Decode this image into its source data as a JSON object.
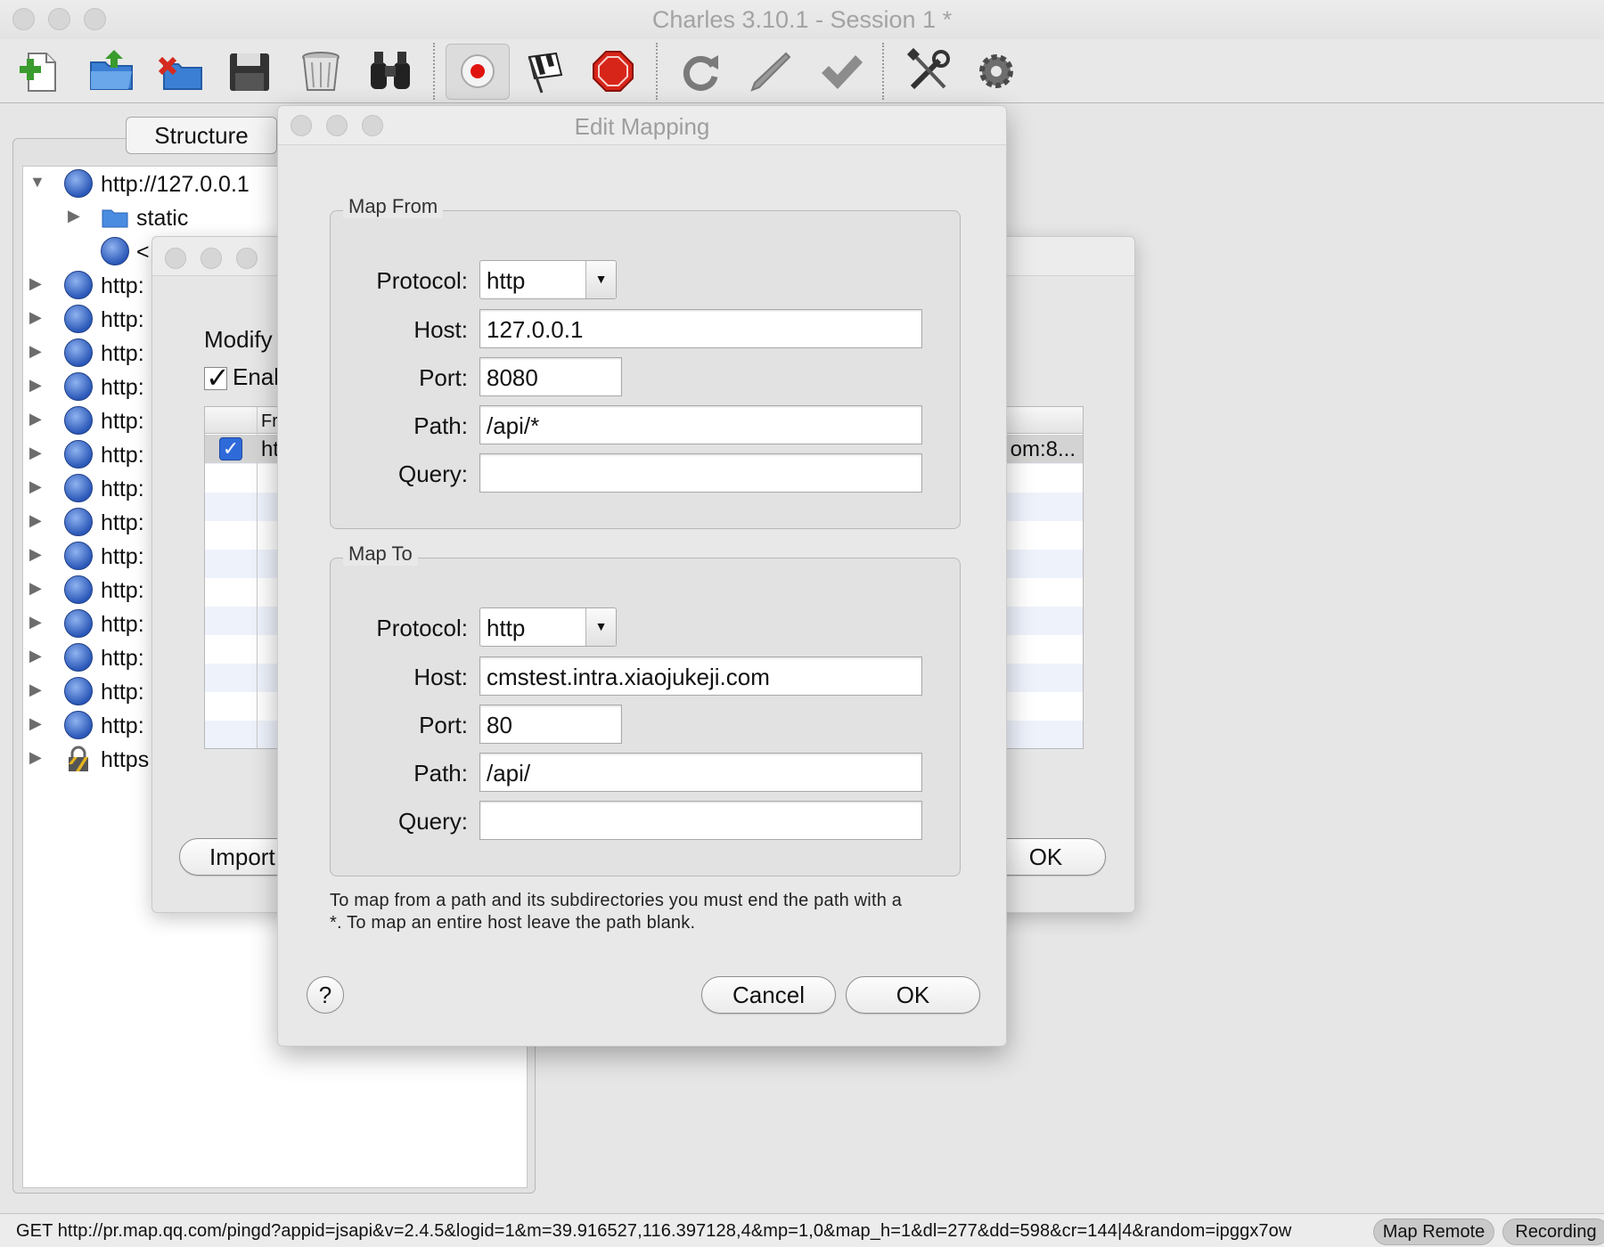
{
  "window": {
    "title": "Charles 3.10.1 - Session 1 *"
  },
  "toolbar": {
    "buttons": [
      {
        "icon": "new-session-icon",
        "tooltip": "New Session"
      },
      {
        "icon": "open-session-icon",
        "tooltip": "Open Session"
      },
      {
        "icon": "close-session-icon",
        "tooltip": "Close Session"
      },
      {
        "icon": "save-icon",
        "tooltip": "Save"
      },
      {
        "icon": "trash-icon",
        "tooltip": "Clear"
      },
      {
        "icon": "binoculars-icon",
        "tooltip": "Find"
      },
      {
        "icon": "record-icon",
        "tooltip": "Recording"
      },
      {
        "icon": "throttle-flag-icon",
        "tooltip": "Throttling"
      },
      {
        "icon": "stop-icon",
        "tooltip": "Breakpoints"
      },
      {
        "icon": "repeat-icon",
        "tooltip": "Repeat"
      },
      {
        "icon": "edit-pen-icon",
        "tooltip": "Edit"
      },
      {
        "icon": "validate-check-icon",
        "tooltip": "Validate"
      },
      {
        "icon": "tools-icon",
        "tooltip": "Tools"
      },
      {
        "icon": "settings-gear-icon",
        "tooltip": "Settings"
      }
    ]
  },
  "left_panel": {
    "tab_label": "Structure",
    "tree": [
      {
        "label": "http://127.0.0.1",
        "icon": "globe-icon",
        "expanded": true,
        "level": 0
      },
      {
        "label": "static",
        "icon": "folder-icon",
        "expanded": false,
        "level": 1
      },
      {
        "label": "<",
        "icon": "globe-icon",
        "level": 1
      },
      {
        "label": "http:",
        "icon": "globe-icon",
        "level": 0
      },
      {
        "label": "http:",
        "icon": "globe-icon",
        "level": 0
      },
      {
        "label": "http:",
        "icon": "globe-icon",
        "level": 0
      },
      {
        "label": "http:",
        "icon": "globe-icon",
        "level": 0
      },
      {
        "label": "http:",
        "icon": "globe-icon",
        "level": 0
      },
      {
        "label": "http:",
        "icon": "globe-icon",
        "level": 0
      },
      {
        "label": "http:",
        "icon": "globe-icon",
        "level": 0
      },
      {
        "label": "http:",
        "icon": "globe-icon",
        "level": 0
      },
      {
        "label": "http:",
        "icon": "globe-icon",
        "level": 0
      },
      {
        "label": "http:",
        "icon": "globe-icon",
        "level": 0
      },
      {
        "label": "http:",
        "icon": "globe-icon",
        "level": 0
      },
      {
        "label": "http:",
        "icon": "globe-icon",
        "level": 0
      },
      {
        "label": "http:",
        "icon": "globe-icon",
        "level": 0
      },
      {
        "label": "http:",
        "icon": "globe-icon",
        "level": 0
      },
      {
        "label": "https",
        "icon": "lock-icon",
        "level": 0
      }
    ]
  },
  "map_remote_dialog": {
    "heading": "Modify",
    "enable_label": "Enal",
    "enable_checked": true,
    "table_header_from": "Fr",
    "row_from": "ht",
    "row_to": "om:8...",
    "row_enabled": true,
    "import_label": "Import",
    "ok_label": "OK"
  },
  "edit_mapping": {
    "title": "Edit Mapping",
    "map_from": {
      "legend": "Map From",
      "protocol_label": "Protocol:",
      "protocol": "http",
      "host_label": "Host:",
      "host": "127.0.0.1",
      "port_label": "Port:",
      "port": "8080",
      "path_label": "Path:",
      "path": "/api/*",
      "query_label": "Query:",
      "query": ""
    },
    "map_to": {
      "legend": "Map To",
      "protocol_label": "Protocol:",
      "protocol": "http",
      "host_label": "Host:",
      "host": "cmstest.intra.xiaojukeji.com",
      "port_label": "Port:",
      "port": "80",
      "path_label": "Path:",
      "path": "/api/",
      "query_label": "Query:",
      "query": ""
    },
    "hint_line1": "To map from a path and its subdirectories you must end the path with a",
    "hint_line2": "*. To map an entire host leave the path blank.",
    "help_label": "?",
    "cancel_label": "Cancel",
    "ok_label": "OK"
  },
  "statusbar": {
    "text": "GET http://pr.map.qq.com/pingd?appid=jsapi&v=2.4.5&logid=1&m=39.916527,116.397128,4&mp=1,0&map_h=1&dl=277&dd=598&cr=144|4&random=ipggx7ow",
    "map_remote_label": "Map Remote",
    "recording_label": "Recording"
  }
}
